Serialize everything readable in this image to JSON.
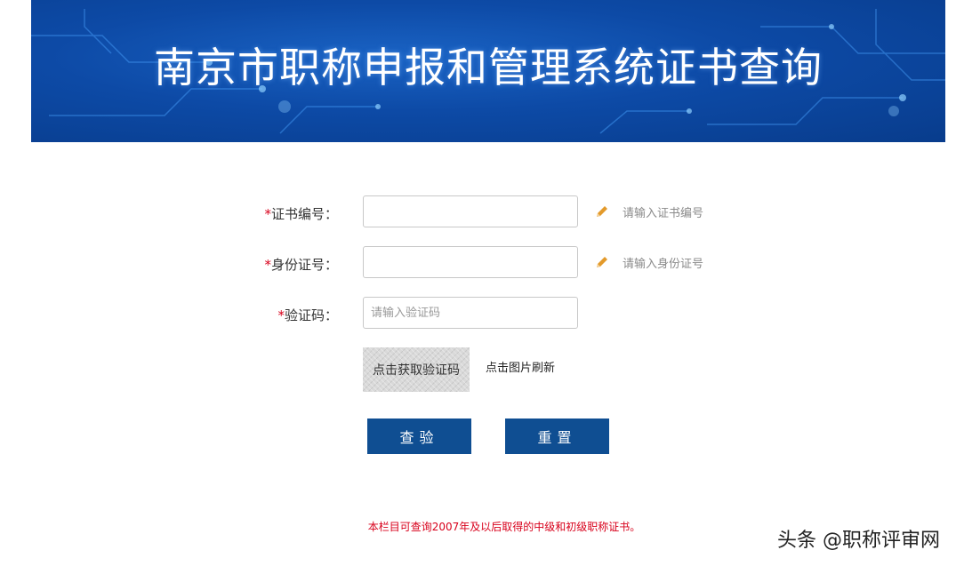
{
  "header": {
    "title": "南京市职称申报和管理系统证书查询"
  },
  "form": {
    "required_mark": "*",
    "cert_number": {
      "label": "证书编号：",
      "value": "",
      "placeholder": "",
      "hint": "请输入证书编号"
    },
    "id_number": {
      "label": "身份证号：",
      "value": "",
      "placeholder": "",
      "hint": "请输入身份证号"
    },
    "captcha": {
      "label": "验证码：",
      "value": "",
      "placeholder": "请输入验证码"
    },
    "captcha_image_text": "点击获取验证码",
    "refresh_text": "点击图片刷新",
    "submit_label": "查验",
    "reset_label": "重置"
  },
  "notice": "本栏目可查询2007年及以后取得的中级和初级职称证书。",
  "watermark": "头条 @职称评审网",
  "colors": {
    "banner": "#0d4aa6",
    "button": "#0f4e92",
    "required": "#d8001b",
    "hint_icon": "#e39a2b"
  },
  "icons": {
    "hint": "pencil-icon"
  }
}
